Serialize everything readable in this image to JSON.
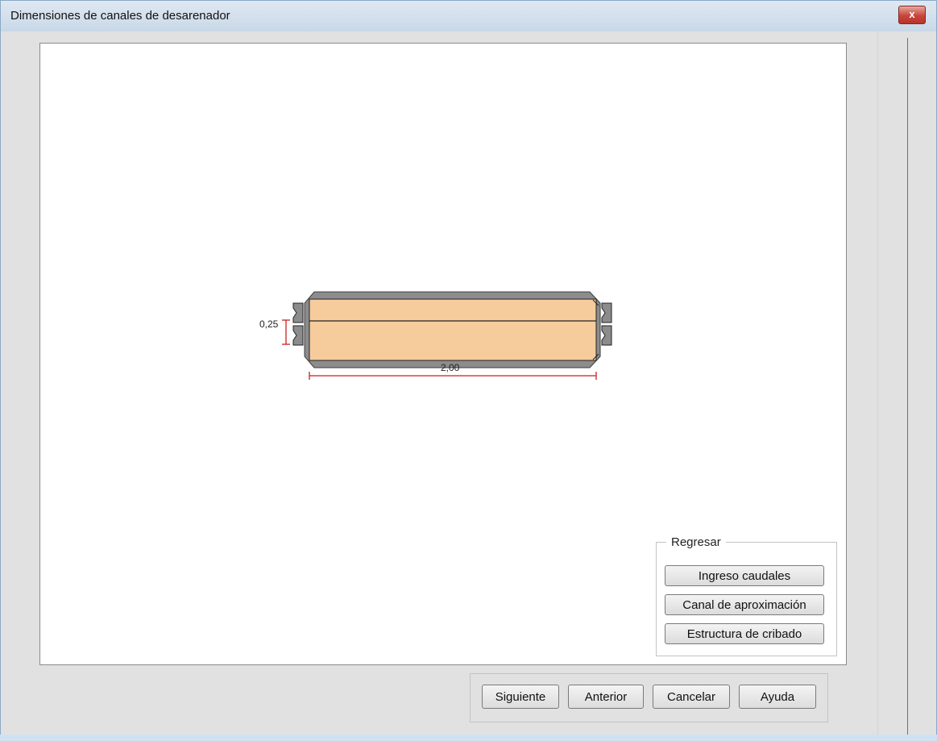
{
  "window": {
    "title": "Dimensiones de canales de desarenador",
    "close_label": "x"
  },
  "diagram": {
    "width_dim": "0,25",
    "length_dim": "2,00",
    "fill_color": "#f7cc9c",
    "wall_color": "#8c8c8c",
    "dim_color": "#cc1f1f"
  },
  "regresar": {
    "legend": "Regresar",
    "buttons": [
      "Ingreso caudales",
      "Canal de aproximación",
      "Estructura de cribado"
    ]
  },
  "nav": {
    "next": "Siguiente",
    "prev": "Anterior",
    "cancel": "Cancelar",
    "help": "Ayuda"
  }
}
